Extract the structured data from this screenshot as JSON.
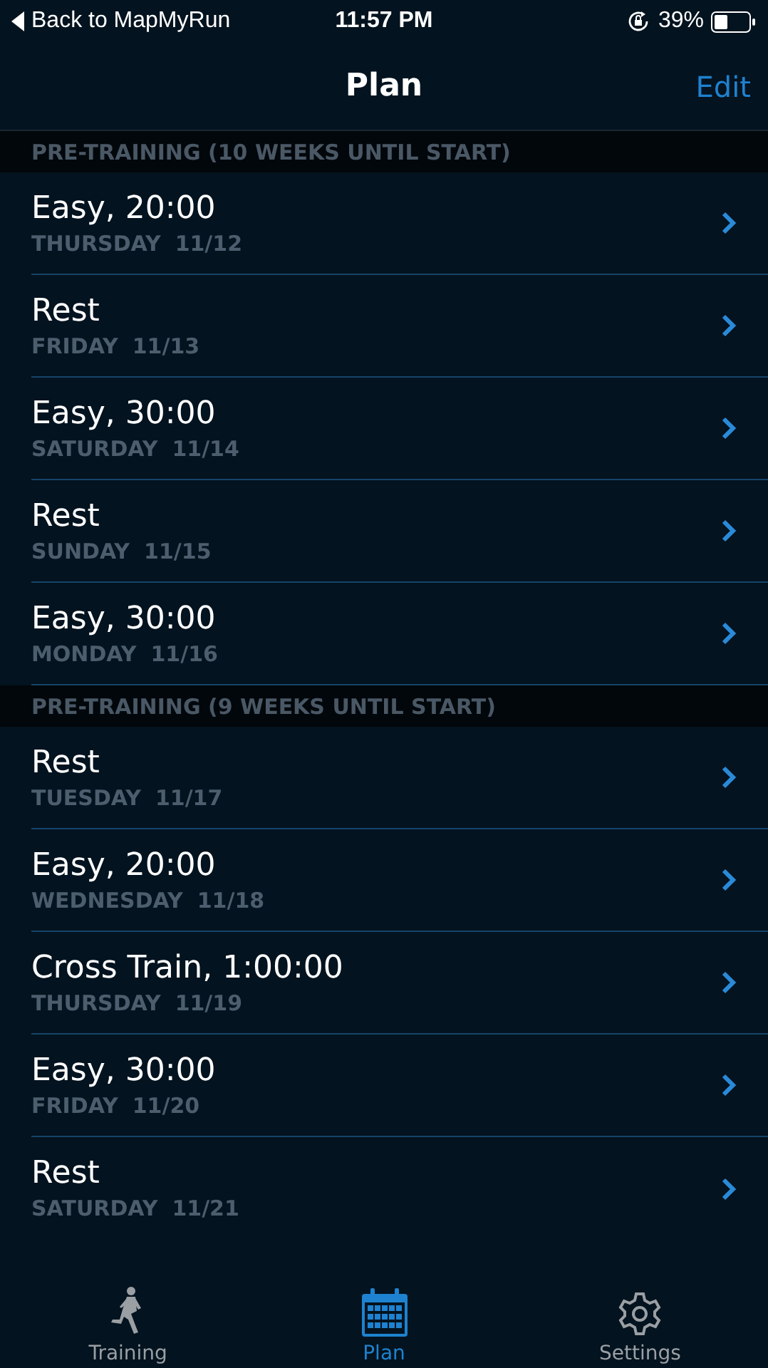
{
  "status_bar": {
    "back": "Back to MapMyRun",
    "time": "11:57 PM",
    "battery": "39%"
  },
  "nav": {
    "title": "Plan",
    "action": "Edit"
  },
  "sections": [
    {
      "title": "PRE-TRAINING (10 WEEKS UNTIL START)",
      "rows": [
        {
          "workout": "Easy, 20:00",
          "day": "THURSDAY",
          "date": "11/12"
        },
        {
          "workout": "Rest",
          "day": "FRIDAY",
          "date": "11/13"
        },
        {
          "workout": "Easy, 30:00",
          "day": "SATURDAY",
          "date": "11/14"
        },
        {
          "workout": "Rest",
          "day": "SUNDAY",
          "date": "11/15"
        },
        {
          "workout": "Easy, 30:00",
          "day": "MONDAY",
          "date": "11/16"
        }
      ]
    },
    {
      "title": "PRE-TRAINING (9 WEEKS UNTIL START)",
      "rows": [
        {
          "workout": "Rest",
          "day": "TUESDAY",
          "date": "11/17"
        },
        {
          "workout": "Easy, 20:00",
          "day": "WEDNESDAY",
          "date": "11/18"
        },
        {
          "workout": "Cross Train, 1:00:00",
          "day": "THURSDAY",
          "date": "11/19"
        },
        {
          "workout": "Easy, 30:00",
          "day": "FRIDAY",
          "date": "11/20"
        },
        {
          "workout": "Rest",
          "day": "SATURDAY",
          "date": "11/21"
        }
      ]
    }
  ],
  "tab_bar": [
    {
      "kind": "training",
      "label": "Training",
      "selected": false
    },
    {
      "kind": "plan",
      "label": "Plan",
      "selected": true
    },
    {
      "kind": "settings",
      "label": "Settings",
      "selected": false
    }
  ]
}
